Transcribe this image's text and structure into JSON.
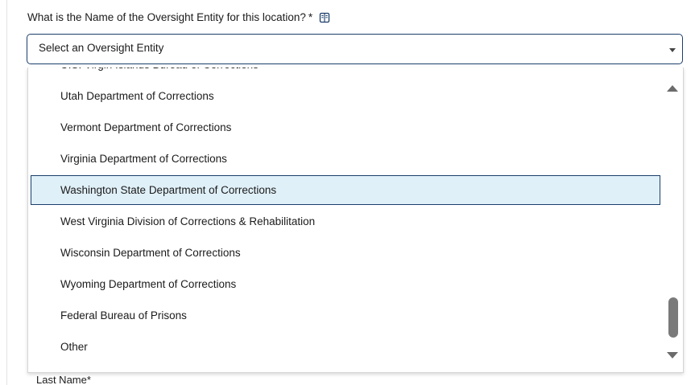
{
  "form": {
    "question_text": "What is the Name of the Oversight Entity for this location?",
    "required_marker": "*",
    "info_icon": "info-book-icon",
    "last_name_label": "Last Name",
    "last_name_required": "*"
  },
  "select": {
    "placeholder": "Select an Oversight Entity",
    "caret_icon": "chevron-down-icon"
  },
  "dropdown": {
    "options": [
      {
        "label": "U.S. Virgin Islands Bureau of Corrections",
        "highlighted": false,
        "partially_visible": true
      },
      {
        "label": "Utah Department of Corrections",
        "highlighted": false
      },
      {
        "label": "Vermont Department of Corrections",
        "highlighted": false
      },
      {
        "label": "Virginia Department of Corrections",
        "highlighted": false
      },
      {
        "label": "Washington State Department of Corrections",
        "highlighted": true
      },
      {
        "label": "West Virginia Division of Corrections & Rehabilitation",
        "highlighted": false
      },
      {
        "label": "Wisconsin Department of Corrections",
        "highlighted": false
      },
      {
        "label": "Wyoming Department of Corrections",
        "highlighted": false
      },
      {
        "label": "Federal Bureau of Prisons",
        "highlighted": false
      },
      {
        "label": "Other",
        "highlighted": false
      }
    ],
    "scroll_position_fraction": 0.9
  },
  "colors": {
    "accent_border": "#1a3e6b",
    "highlight_bg": "#e0f0f8",
    "scroll_thumb": "#7a7a7a"
  }
}
